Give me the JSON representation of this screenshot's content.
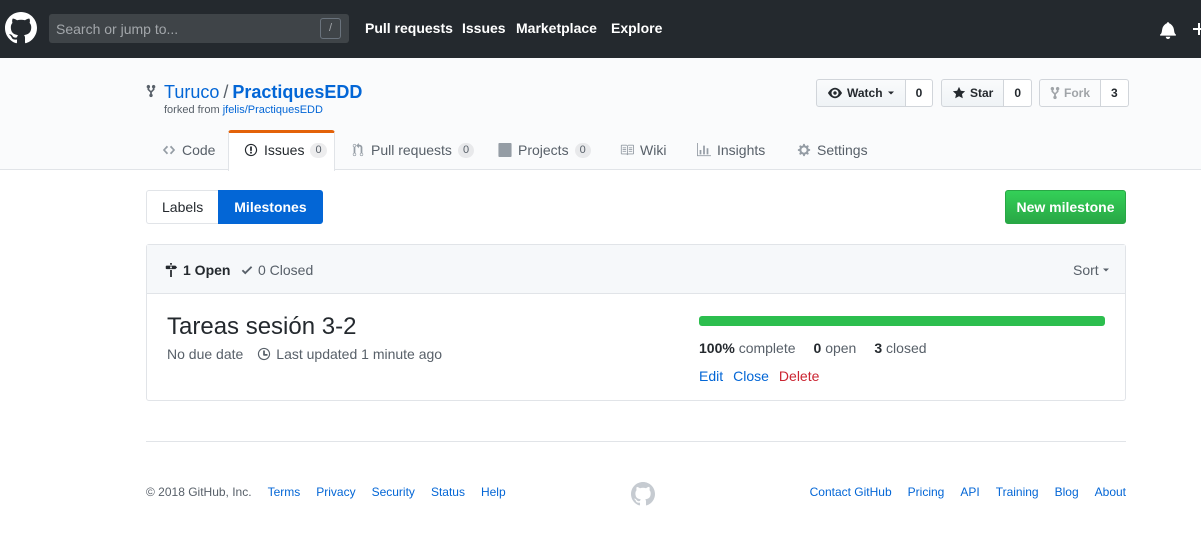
{
  "header": {
    "search_placeholder": "Search or jump to...",
    "slash_hint": "/",
    "nav": [
      "Pull requests",
      "Issues",
      "Marketplace",
      "Explore"
    ]
  },
  "repo": {
    "owner": "Turuco",
    "separator": "/",
    "name": "PractiquesEDD",
    "forked_from_prefix": "forked from ",
    "forked_from": "jfelis/PractiquesEDD",
    "watch_label": "Watch",
    "watch_count": "0",
    "star_label": "Star",
    "star_count": "0",
    "fork_label": "Fork",
    "fork_count": "3"
  },
  "tabs": [
    {
      "label": "Code",
      "icon": "code-icon"
    },
    {
      "label": "Issues",
      "icon": "issue-opened-icon",
      "count": "0"
    },
    {
      "label": "Pull requests",
      "icon": "git-pull-request-icon",
      "count": "0"
    },
    {
      "label": "Projects",
      "icon": "project-icon",
      "count": "0"
    },
    {
      "label": "Wiki",
      "icon": "book-icon"
    },
    {
      "label": "Insights",
      "icon": "graph-icon"
    },
    {
      "label": "Settings",
      "icon": "gear-icon"
    }
  ],
  "subnav": {
    "labels": "Labels",
    "milestones": "Milestones",
    "new_milestone": "New milestone"
  },
  "listing": {
    "open_count_label": "1 Open",
    "closed_count_label": "0 Closed",
    "sort_label": "Sort"
  },
  "milestone": {
    "title": "Tareas sesión 3-2",
    "due": "No due date",
    "updated": "Last updated 1 minute ago",
    "progress_percent": 100,
    "complete_value": "100%",
    "complete_suffix": " complete",
    "open_value": "0",
    "open_suffix": " open",
    "closed_value": "3",
    "closed_suffix": " closed",
    "edit": "Edit",
    "close": "Close",
    "delete": "Delete"
  },
  "footer": {
    "copyright": "© 2018 GitHub, Inc.",
    "left_links": [
      "Terms",
      "Privacy",
      "Security",
      "Status",
      "Help"
    ],
    "right_links": [
      "Contact GitHub",
      "Pricing",
      "API",
      "Training",
      "Blog",
      "About"
    ]
  },
  "colors": {
    "header_bg": "#24292e",
    "link": "#0366d6",
    "primary_green": "#28a745",
    "progress": "#2cbe4e",
    "danger": "#cb2431",
    "tab_accent": "#e36209"
  }
}
